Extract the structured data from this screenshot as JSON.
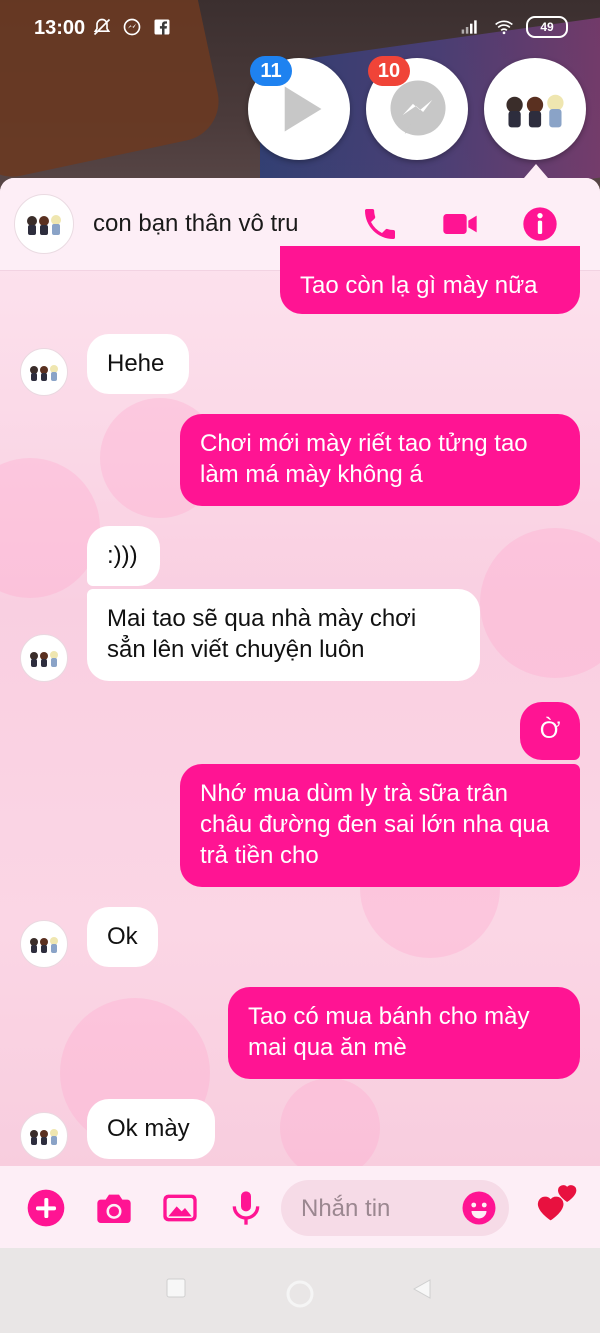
{
  "status_bar": {
    "time": "13:00",
    "battery": "49",
    "left_icons": [
      "bell-off-icon",
      "messenger-icon",
      "facebook-icon"
    ],
    "right_icons": [
      "signal-icon",
      "wifi-icon",
      "battery-icon"
    ]
  },
  "chat_heads": [
    {
      "name": "video-chathead",
      "badge": "11",
      "badge_color": "#1e82f0",
      "icon": "play-icon"
    },
    {
      "name": "messenger-chathead",
      "badge": "10",
      "badge_color": "#f04438",
      "icon": "messenger-icon"
    },
    {
      "name": "group-chathead",
      "icon": "group-avatar-icon"
    }
  ],
  "header": {
    "title": "con bạn thân vô tru",
    "buttons": [
      "phone-icon",
      "video-camera-icon",
      "info-icon"
    ]
  },
  "messages": [
    {
      "dir": "out",
      "text": "Tao còn lạ gì mày nữa"
    },
    {
      "dir": "in",
      "text": "Hehe"
    },
    {
      "dir": "out",
      "text": "Chơi mới mày riết tao tửng tao làm má mày không á"
    },
    {
      "dir": "in",
      "text": ":)))"
    },
    {
      "dir": "in",
      "text": "Mai tao sẽ qua nhà mày chơi sẳn lên viết chuyện luôn"
    },
    {
      "dir": "out",
      "text": "Ờ"
    },
    {
      "dir": "out",
      "text": "Nhớ mua dùm ly trà sữa trân châu đường đen sai lớn nha qua trả tiền cho"
    },
    {
      "dir": "in",
      "text": "Ok"
    },
    {
      "dir": "out",
      "text": "Tao có mua bánh cho mày mai qua ăn mè"
    },
    {
      "dir": "in",
      "text": "Ok mày"
    }
  ],
  "composer": {
    "placeholder": "Nhắn tin",
    "buttons": [
      "add-icon",
      "camera-icon",
      "image-icon",
      "microphone-icon",
      "emoji-icon",
      "hearts-icon"
    ]
  },
  "colors": {
    "accent": "#ff1493",
    "panel_bg": "#fdeef6"
  },
  "nav_bar": {
    "buttons": [
      "recent-apps-icon",
      "home-icon",
      "back-icon"
    ]
  }
}
